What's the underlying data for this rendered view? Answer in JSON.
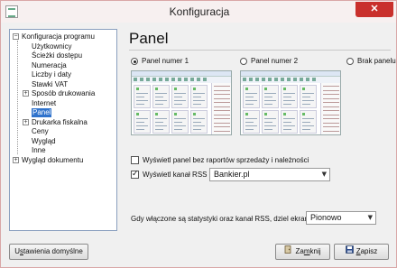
{
  "window": {
    "title": "Konfiguracja",
    "close_label": "✕"
  },
  "tree": {
    "items": [
      {
        "label": "Konfiguracja programu",
        "expander": "−"
      },
      {
        "label": "Użytkownicy"
      },
      {
        "label": "Ścieżki dostępu"
      },
      {
        "label": "Numeracja"
      },
      {
        "label": "Liczby i daty"
      },
      {
        "label": "Stawki VAT"
      },
      {
        "label": "Sposób drukowania",
        "expander": "+"
      },
      {
        "label": "Internet"
      },
      {
        "label": "Panel",
        "selected": true
      },
      {
        "label": "Drukarka fiskalna",
        "expander": "+"
      },
      {
        "label": "Ceny"
      },
      {
        "label": "Wygląd"
      },
      {
        "label": "Inne"
      },
      {
        "label": "Wygląd dokumentu",
        "expander": "+"
      }
    ]
  },
  "panel": {
    "title": "Panel",
    "options": [
      {
        "label": "Panel numer 1",
        "selected": true
      },
      {
        "label": "Panel numer 2",
        "selected": false
      },
      {
        "label": "Brak panelu",
        "selected": false
      }
    ]
  },
  "settings": {
    "no_reports_label": "Wyświetl panel bez raportów sprzedaży i należności",
    "no_reports_checked": false,
    "rss_label": "Wyświetl kanał RSS",
    "rss_checked": true,
    "rss_source": "Bankier.pl",
    "stats_label": "Gdy włączone są statystyki oraz kanał RSS, dziel ekran:",
    "split_mode": "Pionowo",
    "dropdown_arrow": "▼"
  },
  "buttons": {
    "defaults_label": "Ustawienia domyślne",
    "defaults_underline": "s",
    "close_label": "Zamknij",
    "close_underline": "m",
    "save_label": "Zapisz",
    "save_underline": "Z"
  },
  "colors": {
    "selection": "#3073cc",
    "close_button": "#c9302c"
  }
}
